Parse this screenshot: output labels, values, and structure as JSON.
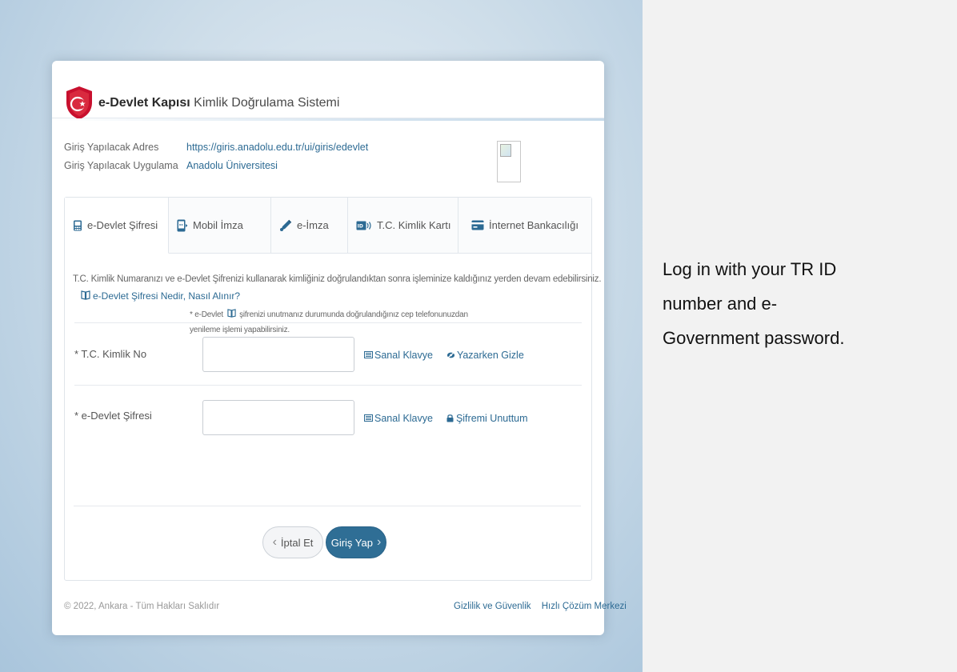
{
  "header": {
    "brand_bold": "e-Devlet Kapısı",
    "brand_light": "Kimlik Doğrulama Sistemi"
  },
  "info": {
    "address_label": "Giriş Yapılacak Adres",
    "address_value": "https://giris.anadolu.edu.tr/ui/giris/edevlet",
    "app_label": "Giriş Yapılacak Uygulama",
    "app_value": "Anadolu Üniversitesi"
  },
  "tabs": [
    {
      "label": "e-Devlet Şifresi",
      "icon": "phone-icon"
    },
    {
      "label": "Mobil İmza",
      "icon": "mobile-signature-icon"
    },
    {
      "label": "e-İmza",
      "icon": "pen-icon"
    },
    {
      "label": "T.C. Kimlik Kartı",
      "icon": "id-card-icon"
    },
    {
      "label": "İnternet Bankacılığı",
      "icon": "bank-card-icon"
    }
  ],
  "content": {
    "description": "T.C. Kimlik Numaranızı ve e-Devlet Şifrenizi kullanarak kimliğiniz doğrulandıktan sonra işleminize kaldığınız yerden devam edebilirsiniz.",
    "help_link": "e-Devlet Şifresi Nedir, Nasıl Alınır?",
    "tc_label": "* T.C. Kimlik No",
    "tc_value": "",
    "password_label": "* e-Devlet Şifresi",
    "password_value": "",
    "virtual_keyboard": "Sanal Klavye",
    "hide_while_typing": "Yazarken Gizle",
    "forgot_password": "Şifremi Unuttum",
    "note_prefix": "* e-Devlet",
    "note_rest": "şifrenizi unutmanız durumunda doğrulandığınız cep telefonunuzdan yenileme işlemi yapabilirsiniz."
  },
  "buttons": {
    "cancel": "İptal Et",
    "login": "Giriş Yap"
  },
  "footer": {
    "copyright": "© 2022, Ankara - Tüm Hakları Saklıdır",
    "privacy": "Gizlilik ve Güvenlik",
    "support": "Hızlı Çözüm Merkezi"
  },
  "side": {
    "text": " Log in with your TR ID\nnumber and e-\nGovernment password."
  },
  "colors": {
    "accent": "#2f6e95",
    "link": "#2c6a93",
    "brand_red": "#c8102e"
  }
}
